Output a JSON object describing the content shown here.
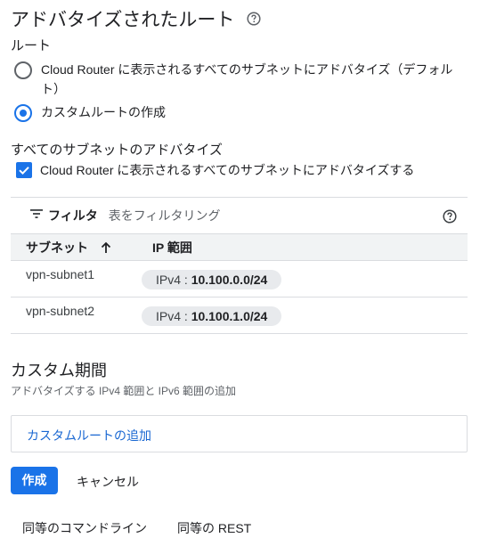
{
  "header": {
    "title": "アドバタイズされたルート",
    "help_icon": "help-circle-icon"
  },
  "route_section": {
    "label": "ルート",
    "options": [
      {
        "label_line1": "Cloud Router に表示されるすべてのサブネットにアドバタイズ（デフォル",
        "label_line2": "ト）",
        "selected": false
      },
      {
        "label_line1": "カスタムルートの作成",
        "selected": true
      }
    ]
  },
  "subnet_advertise": {
    "label": "すべてのサブネットのアドバタイズ",
    "checkbox_label": "Cloud Router に表示されるすべてのサブネットにアドバタイズする",
    "checked": true
  },
  "table": {
    "filter_label": "フィルタ",
    "filter_placeholder": "表をフィルタリング",
    "columns": {
      "subnet": "サブネット",
      "ip_range": "IP 範囲"
    },
    "sort_icon": "arrow-up-icon",
    "rows": [
      {
        "subnet": "vpn-subnet1",
        "ip_prefix": "IPv4 : ",
        "ip_value": "10.100.0.0/24"
      },
      {
        "subnet": "vpn-subnet2",
        "ip_prefix": "IPv4 : ",
        "ip_value": "10.100.1.0/24"
      }
    ]
  },
  "custom_range": {
    "title": "カスタム期間",
    "subtitle": "アドバタイズする IPv4 範囲と IPv6 範囲の追加",
    "add_label": "カスタムルートの追加"
  },
  "actions": {
    "create": "作成",
    "cancel": "キャンセル"
  },
  "footer": {
    "command_line": "同等のコマンドライン",
    "rest": "同等の REST"
  },
  "colors": {
    "accent": "#1a73e8",
    "link": "#1967d2",
    "chip_bg": "#e8eaed",
    "header_bg": "#f1f3f4"
  }
}
